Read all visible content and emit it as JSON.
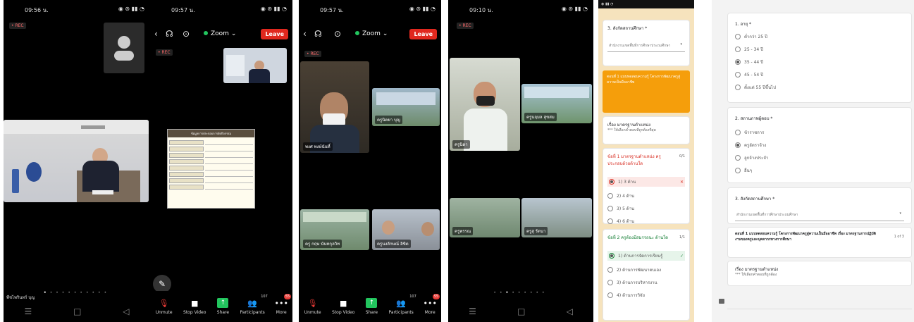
{
  "screens": {
    "p1": {
      "time": "09:56 น.",
      "rec": "• REC",
      "name_label": "พืชไพรินทร์ บุญ",
      "nav": [
        "☰",
        "□",
        "◁"
      ]
    },
    "p2": {
      "time": "09:57 น.",
      "rec": "• REC",
      "zoom_label": "Zoom",
      "leave": "Leave",
      "toolbar": [
        "Unmute",
        "Stop Video",
        "Share",
        "Participants",
        "More"
      ],
      "participants_count": "107",
      "more_badge": "55",
      "slide_title": "ข้อมูลการประกอบการจัดกิจกรรม"
    },
    "p3": {
      "time": "09:57 น.",
      "rec": "• REC",
      "zoom_label": "Zoom",
      "leave": "Leave",
      "toolbar": [
        "Unmute",
        "Stop Video",
        "Share",
        "Participants",
        "More"
      ],
      "participants_count": "107",
      "more_badge": "55",
      "labels": [
        "พงศ พงษ์นันทิ์",
        "ครูนิตยา บุญ",
        "ครู กฤษ นันทกุลวิท",
        "ครูนงลักษณ์ ลิขิต",
        "ครูพรรณภา"
      ]
    },
    "p4": {
      "time": "09:10 น.",
      "rec": "• REC",
      "labels": [
        "ครูนิดา",
        "ครูนฤมล สุขสม",
        "ครูพรรณ",
        "ครูสุ รัตนา"
      ],
      "nav": [
        "☰",
        "□",
        "◁"
      ]
    },
    "p5": {
      "q3_title": "3. สังกัดสถานศึกษา *",
      "q3_value": "สำนักงานเขตพื้นที่การศึกษาประถมศึกษา",
      "banner": "ตอนที่ 1 แบบทดสอบความรู้ โครงการพัฒนาครูสู่ความเป็นมืออาชีพ",
      "section_title": "เรื่อง มาตรฐานตำแหน่ง",
      "section_note": "*** ให้เลือกคำตอบที่ถูกต้องที่สุด",
      "q1": "ข้อที่ 1 มาตรฐานตำแหน่ง ครูประกอบด้วยด้านใด",
      "q1_score": "0/1",
      "q1_opts": [
        "1) 3 ด้าน",
        "2) 4 ด้าน",
        "3) 5 ด้าน",
        "4) 6 ด้าน"
      ],
      "q2": "ข้อที่ 2 ครูต้องมีสมรรถนะ ด้านใด",
      "q2_score": "1/1",
      "q2_opts": [
        "1) ด้านการจัดการเรียนรู้",
        "2) ด้านการพัฒนาตนเอง",
        "3) ด้านการบริหารงาน",
        "4) ด้านการวิจัย"
      ]
    },
    "p6": {
      "q1_title": "1. อายุ *",
      "q1_opts": [
        "ต่ำกว่า 25 ปี",
        "25 - 34 ปี",
        "35 - 44 ปี",
        "45 - 54 ปี",
        "ตั้งแต่ 55 ปีขึ้นไป"
      ],
      "q2_title": "2. สถานภาพผู้ตอบ *",
      "q2_opts": [
        "ข้าราชการ",
        "ครูอัตราจ้าง",
        "ลูกจ้างประจำ",
        "อื่นๆ"
      ],
      "q3_title": "3. สังกัดสถานศึกษา *",
      "q3_value": "สำนักงานเขตพื้นที่การศึกษาประถมศึกษา",
      "section": "ตอนที่ 1 แบบทดสอบความรู้ โครงการพัฒนาครูสู่ความเป็นมืออาชีพ เรื่อง มาตรฐานการปฏิบัติงานของครูและบุคลากรทางการศึกษา",
      "section_side": "1 of 3",
      "sub_title": "เรื่อง มาตรฐานตำแหน่ง",
      "sub_note": "*** ให้เลือกคำตอบที่ถูกต้อง"
    }
  }
}
